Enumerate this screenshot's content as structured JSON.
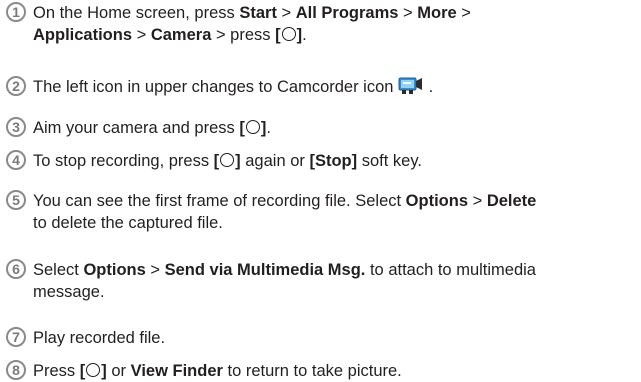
{
  "steps": [
    {
      "number": "1",
      "lines": [
        [
          {
            "t": "On the Home screen, press "
          },
          {
            "t": "Start",
            "b": true
          },
          {
            "t": " > "
          },
          {
            "t": "All Programs",
            "b": true
          },
          {
            "t": " > "
          },
          {
            "t": "More",
            "b": true
          },
          {
            "t": " >"
          }
        ],
        [
          {
            "t": "Applications",
            "b": true
          },
          {
            "t": " > "
          },
          {
            "t": "Camera",
            "b": true
          },
          {
            "t": " > press "
          },
          {
            "t": "[",
            "b": true
          },
          {
            "icon": "circle-button-icon"
          },
          {
            "t": "]",
            "b": true
          },
          {
            "t": "."
          }
        ]
      ]
    },
    {
      "number": "2",
      "lines": [
        [
          {
            "t": "The left icon in upper changes to Camcorder icon "
          },
          {
            "icon": "camcorder-icon"
          },
          {
            "t": " ."
          }
        ]
      ]
    },
    {
      "number": "3",
      "lines": [
        [
          {
            "t": "Aim your camera and press "
          },
          {
            "t": "[",
            "b": true
          },
          {
            "icon": "circle-button-icon"
          },
          {
            "t": "]",
            "b": true
          },
          {
            "t": "."
          }
        ]
      ]
    },
    {
      "number": "4",
      "lines": [
        [
          {
            "t": "To stop recording, press "
          },
          {
            "t": "[",
            "b": true
          },
          {
            "icon": "circle-button-icon"
          },
          {
            "t": "]",
            "b": true
          },
          {
            "t": " again or "
          },
          {
            "t": "[Stop]",
            "b": true
          },
          {
            "t": " soft key."
          }
        ]
      ]
    },
    {
      "number": "5",
      "lines": [
        [
          {
            "t": "You can see the first frame of recording file. Select "
          },
          {
            "t": "Options",
            "b": true
          },
          {
            "t": " > "
          },
          {
            "t": "Delete",
            "b": true
          }
        ],
        [
          {
            "t": "to delete the captured file."
          }
        ]
      ]
    },
    {
      "number": "6",
      "lines": [
        [
          {
            "t": "Select "
          },
          {
            "t": "Options",
            "b": true
          },
          {
            "t": " > "
          },
          {
            "t": "Send via Multimedia Msg.",
            "b": true
          },
          {
            "t": " to attach to multimedia"
          }
        ],
        [
          {
            "t": "message."
          }
        ]
      ]
    },
    {
      "number": "7",
      "lines": [
        [
          {
            "t": "Play recorded file."
          }
        ]
      ]
    },
    {
      "number": "8",
      "lines": [
        [
          {
            "t": "Press "
          },
          {
            "t": "[",
            "b": true
          },
          {
            "icon": "circle-button-icon"
          },
          {
            "t": "]",
            "b": true
          },
          {
            "t": " or "
          },
          {
            "t": "View Finder",
            "b": true
          },
          {
            "t": " to return to take picture."
          }
        ]
      ]
    }
  ]
}
